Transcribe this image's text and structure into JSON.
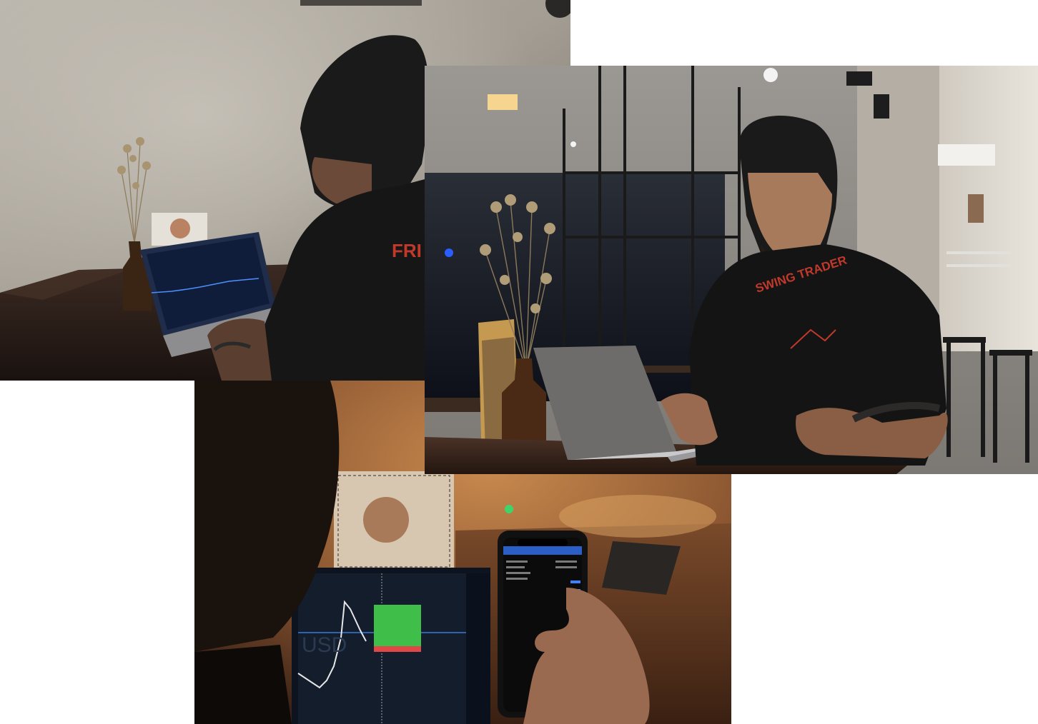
{
  "collage": {
    "photos": [
      {
        "id": "top-left",
        "subject": "man-typing-on-laptop-with-trading-chart",
        "shirt_text": "FRI"
      },
      {
        "id": "right",
        "subject": "man-in-swing-trader-shirt-typing-on-laptop-in-cafe",
        "shirt_text": "SWING TRADER"
      },
      {
        "id": "bottom",
        "subject": "hand-holding-phone-near-candlestick-chart-screen",
        "screen_text": "USD"
      }
    ]
  },
  "colors": {
    "shirt_print": "#c0392b",
    "chart_line": "#4d8fff",
    "candle_up": "#3fbf4a",
    "candle_down": "#e04848"
  }
}
